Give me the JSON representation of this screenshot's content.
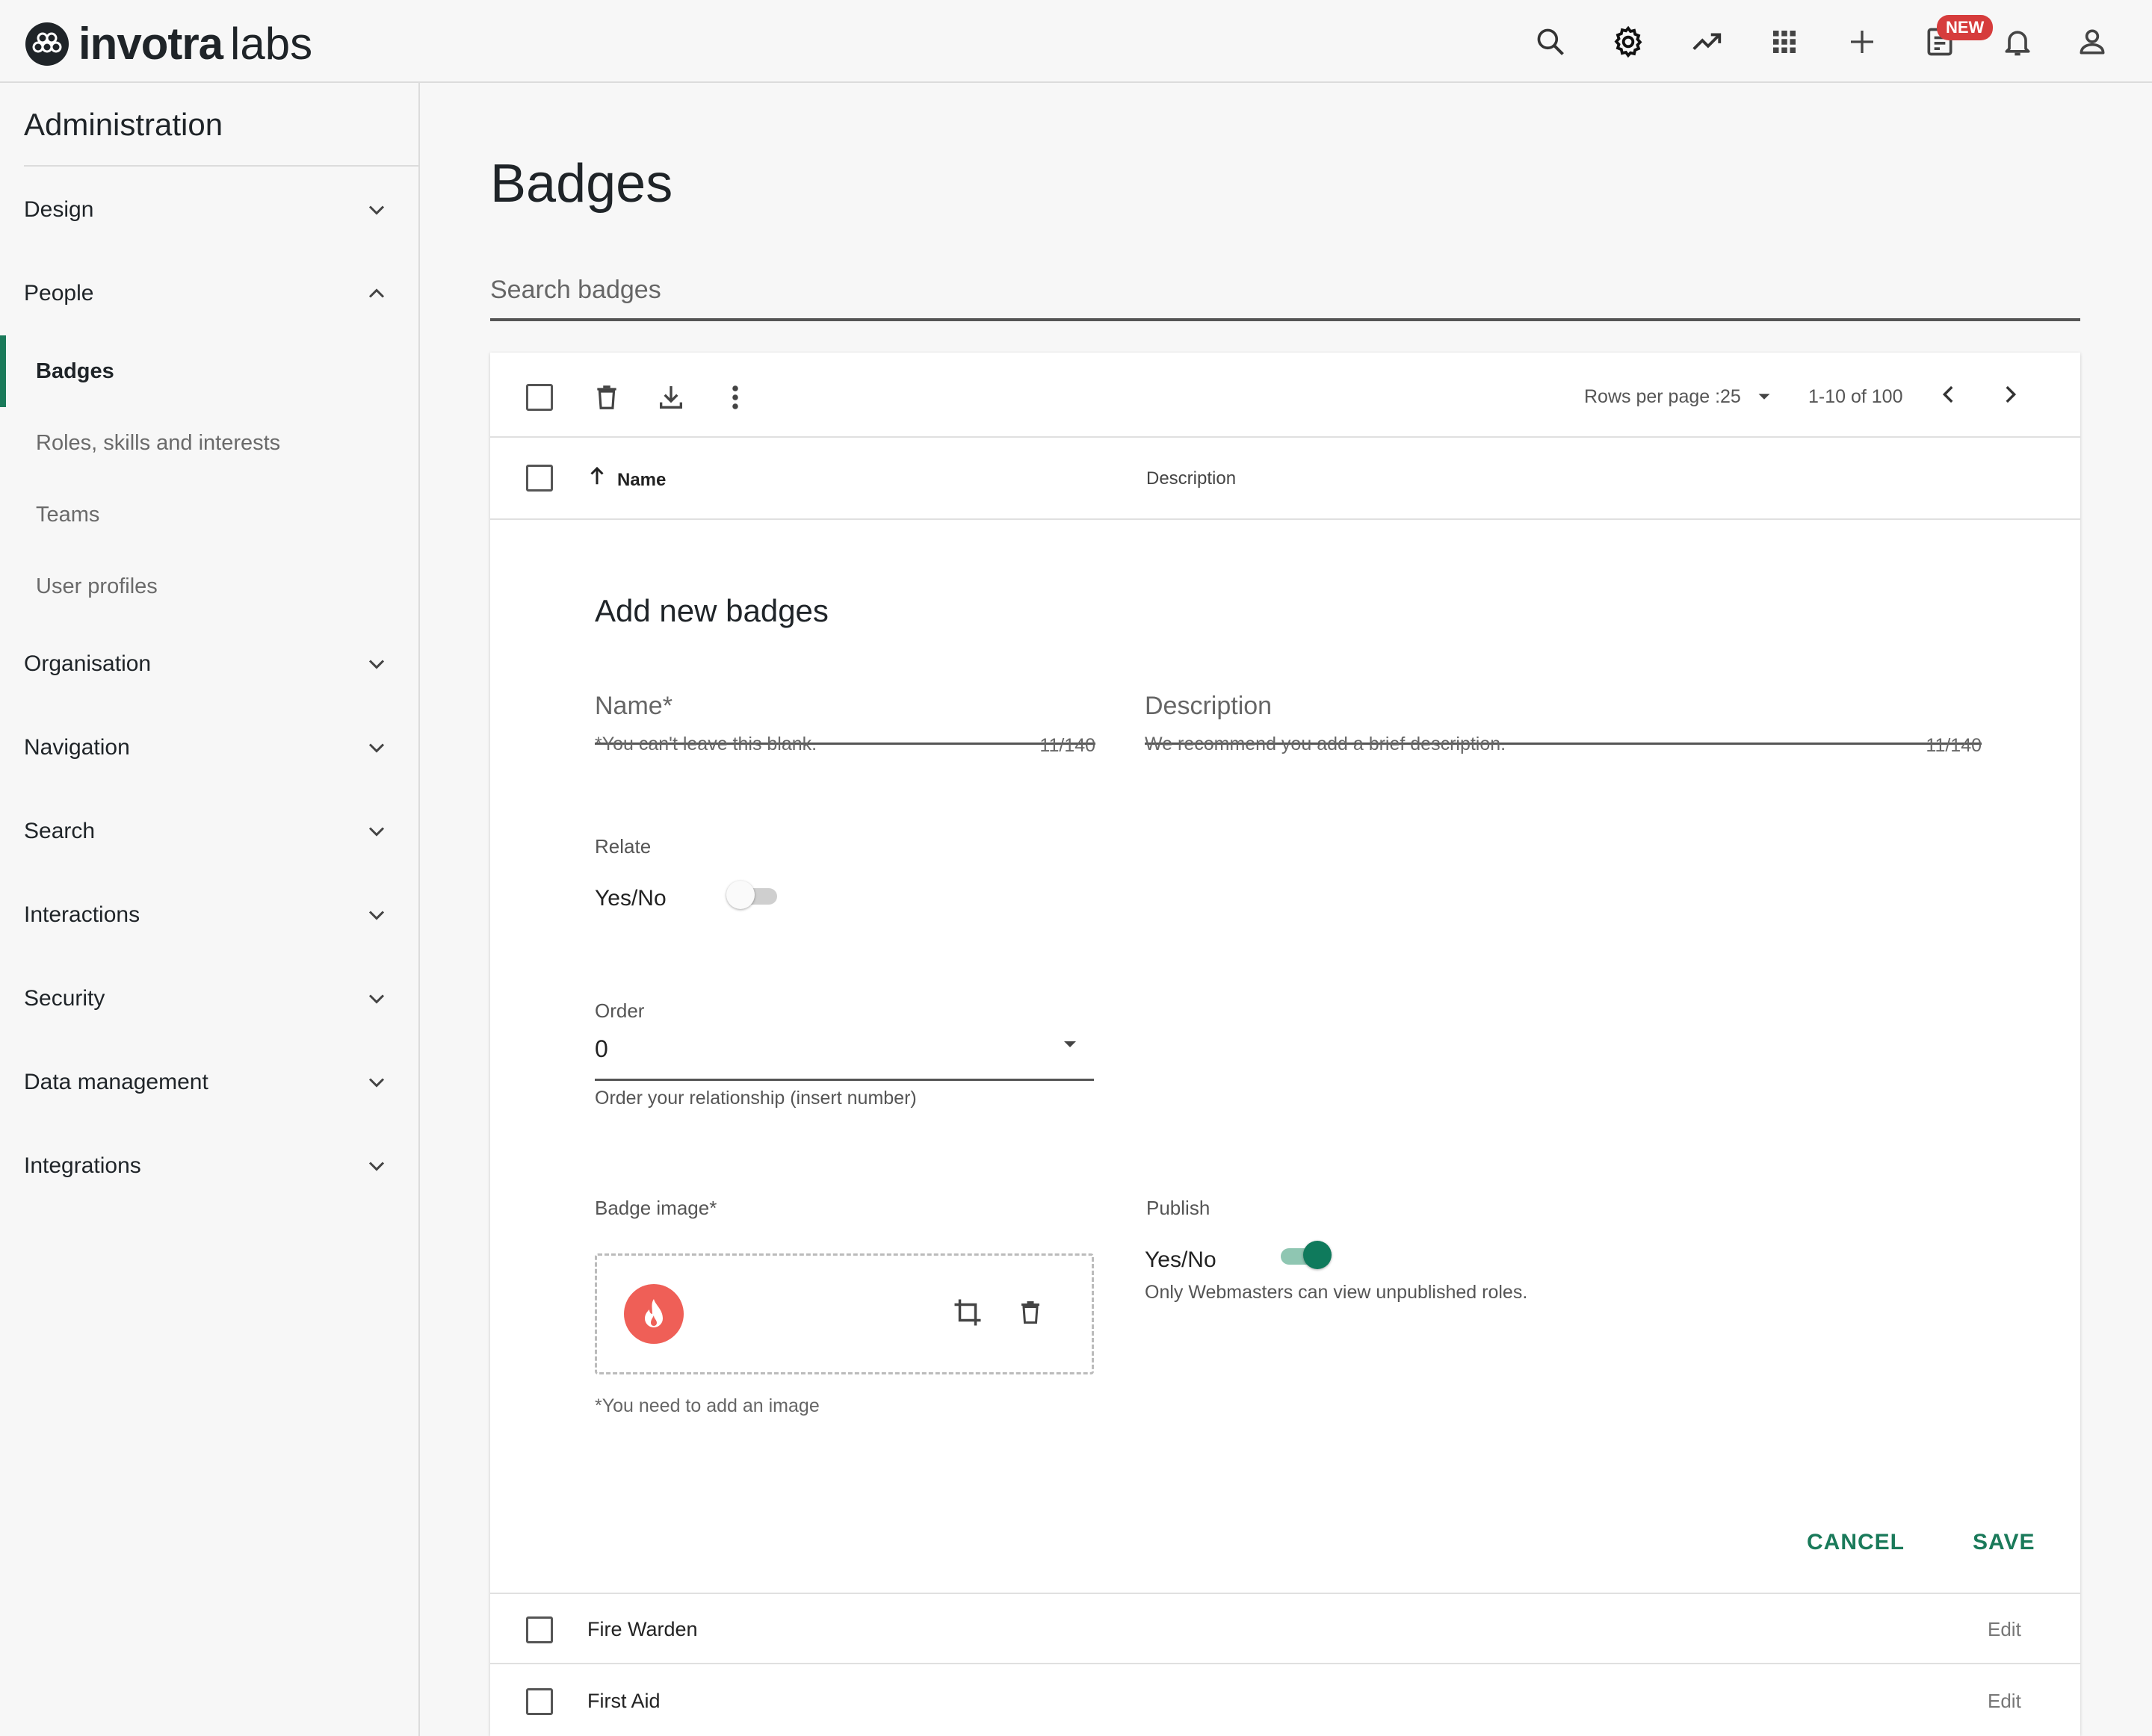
{
  "header": {
    "brand": "invotra",
    "brand_sub": "labs",
    "new_label": "NEW",
    "icons": [
      "search-icon",
      "gear-icon",
      "trending-icon",
      "apps-grid-icon",
      "plus-icon",
      "document-icon",
      "bell-icon",
      "user-icon"
    ]
  },
  "sidebar": {
    "title": "Administration",
    "items": [
      {
        "label": "Design"
      },
      {
        "label": "People"
      },
      {
        "label": "Organisation"
      },
      {
        "label": "Navigation"
      },
      {
        "label": "Search"
      },
      {
        "label": "Interactions"
      },
      {
        "label": "Security"
      },
      {
        "label": "Data management"
      },
      {
        "label": "Integrations"
      }
    ],
    "people_sub": [
      {
        "label": "Badges",
        "active": true
      },
      {
        "label": "Roles, skills and interests"
      },
      {
        "label": "Teams"
      },
      {
        "label": "User profiles"
      }
    ]
  },
  "main": {
    "title": "Badges",
    "search_placeholder": "Search badges"
  },
  "table": {
    "rows_per_page_label": "Rows per page :",
    "rows_per_page_value": "25",
    "range": "1-10 of 100",
    "col_name": "Name",
    "col_description": "Description",
    "rows": [
      {
        "name": "Fire Warden",
        "action": "Edit"
      },
      {
        "name": "First Aid",
        "action": "Edit"
      }
    ]
  },
  "form": {
    "title": "Add new badges",
    "name_label": "Name*",
    "name_helper": "*You can't leave this blank.",
    "name_counter": "11/140",
    "desc_label": "Description",
    "desc_helper": "We recommend you add a brief description.",
    "desc_counter": "11/140",
    "relate_label": "Relate",
    "relate_yesno": "Yes/No",
    "relate_value": false,
    "order_label": "Order",
    "order_value": "0",
    "order_helper": "Order your relationship (insert number)",
    "badge_image_label": "Badge image*",
    "badge_image_helper": "*You need to add an image",
    "publish_label": "Publish",
    "publish_yesno": "Yes/No",
    "publish_value": true,
    "publish_helper": "Only Webmasters can view unpublished roles.",
    "cancel_label": "CANCEL",
    "save_label": "SAVE"
  },
  "colors": {
    "accent": "#1a7a5a",
    "badge_red": "#ef5f57",
    "new_red": "#d63c3c"
  }
}
